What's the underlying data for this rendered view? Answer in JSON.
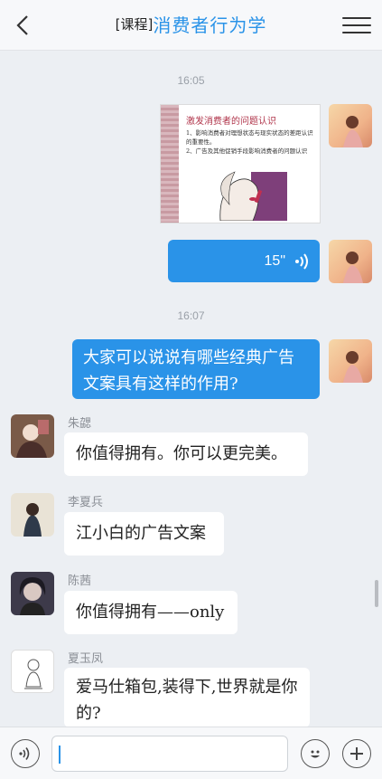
{
  "header": {
    "tag": "[课程]",
    "title": "消费者行为学"
  },
  "messages": {
    "time1": "16:05",
    "image": {
      "title": "激发消费者的问题认识",
      "line1": "1、影响消费者对理想状态与现实状态的差距认识的重要性。",
      "line2": "2、广告及其他促销手段影响消费者的问题认识"
    },
    "voice_duration": "15\"",
    "time2": "16:07",
    "question": "大家可以说说有哪些经典广告文案具有这样的作用?",
    "replies": [
      {
        "sender": "朱勰",
        "text": "你值得拥有。你可以更完美。"
      },
      {
        "sender": "李夏兵",
        "text": "江小白的广告文案"
      },
      {
        "sender": "陈茜",
        "text": "你值得拥有——only"
      },
      {
        "sender": "夏玉凤",
        "text": "爱马仕箱包,装得下,世界就是你的?"
      }
    ]
  },
  "colors": {
    "accent": "#2a93e8",
    "background": "#eceff3"
  },
  "icons": {
    "back": "chevron-left-icon",
    "menu": "hamburger-menu-icon",
    "voice": "voice-wave-icon",
    "emoji": "emoji-icon",
    "add": "plus-icon"
  }
}
